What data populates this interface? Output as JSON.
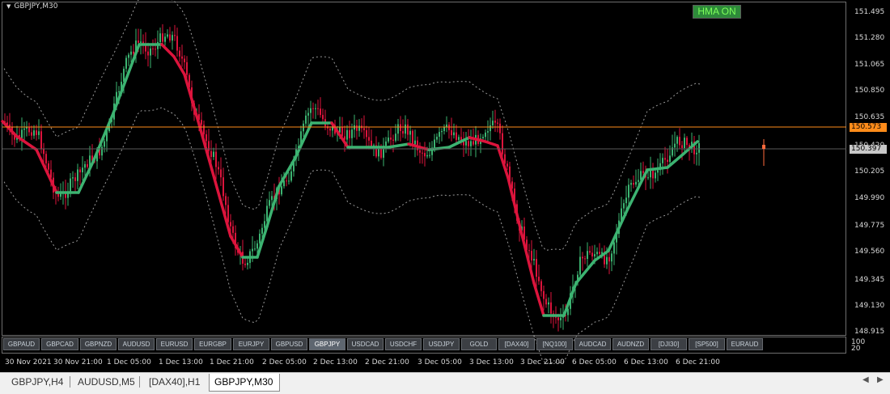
{
  "chart": {
    "symbol": "GBPJPY,M30",
    "hma_button": "HMA ON",
    "price_ticks": [
      "151.495",
      "151.280",
      "151.065",
      "150.850",
      "150.635",
      "150.420",
      "150.205",
      "149.990",
      "149.775",
      "149.560",
      "149.345",
      "149.130",
      "148.915"
    ],
    "price_tags": {
      "orange": "150.573",
      "grey": "150.397"
    },
    "symbol_buttons": [
      "GBPAUD",
      "GBPCAD",
      "GBPNZD",
      "AUDUSD",
      "EURUSD",
      "EURGBP",
      "EURJPY",
      "GBPUSD",
      "GBPJPY",
      "USDCAD",
      "USDCHF",
      "USDJPY",
      "GOLD",
      "[DAX40]",
      "[NQ100]",
      "AUDCAD",
      "AUDNZD",
      "[DJI30]",
      "[SP500]",
      "EURAUD"
    ],
    "active_symbol": "GBPJPY",
    "time_labels": [
      "30 Nov 2021",
      "30 Nov 21:00",
      "1 Dec 05:00",
      "1 Dec 13:00",
      "1 Dec 21:00",
      "2 Dec 05:00",
      "2 Dec 13:00",
      "2 Dec 21:00",
      "3 Dec 05:00",
      "3 Dec 13:00",
      "3 Dec 21:00",
      "6 Dec 05:00",
      "6 Dec 13:00",
      "6 Dec 21:00"
    ],
    "subwindow_scale": [
      "100",
      "20"
    ],
    "colors": {
      "bull": "#3cb371",
      "bear": "#dc143c",
      "hma_up": "#3cb371",
      "hma_down": "#dc143c",
      "orange_line": "#ff8c1a",
      "bands": "#9a9a9a",
      "background": "#000000"
    }
  },
  "tabs": [
    "GBPJPY,H4",
    "AUDUSD,M5",
    "[DAX40],H1",
    "GBPJPY,M30"
  ],
  "active_tab": "GBPJPY,M30",
  "icons": {
    "title_dropdown": "triangle-down-icon",
    "scroll_left": "arrow-left-icon",
    "scroll_right": "arrow-right-icon"
  }
}
